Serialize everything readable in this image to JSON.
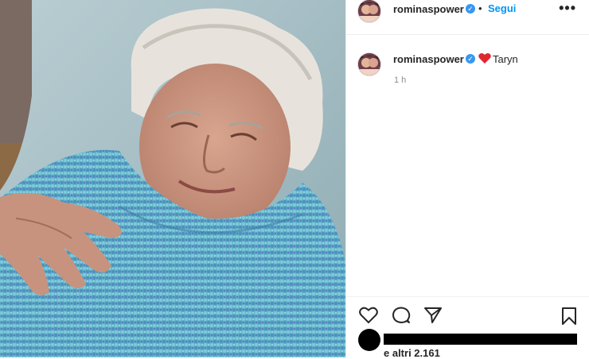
{
  "post": {
    "photo_subject": "photo",
    "header": {
      "username": "rominaspower",
      "separator": "•",
      "follow_label": "Segui",
      "more_label": "•••"
    },
    "caption": {
      "username": "rominaspower",
      "emoji": "heart",
      "text": "Taryn",
      "time": "1 h"
    },
    "actions": {
      "like_icon": "heart-outline-icon",
      "comment_icon": "comment-icon",
      "share_icon": "paper-plane-icon",
      "save_icon": "bookmark-icon"
    },
    "likes_text": "e altri 2.161"
  },
  "colors": {
    "verified": "#3897f0",
    "follow": "#0095f6",
    "muted": "#8e8e8e",
    "text": "#262626",
    "heart_emoji": "#e0262f"
  }
}
